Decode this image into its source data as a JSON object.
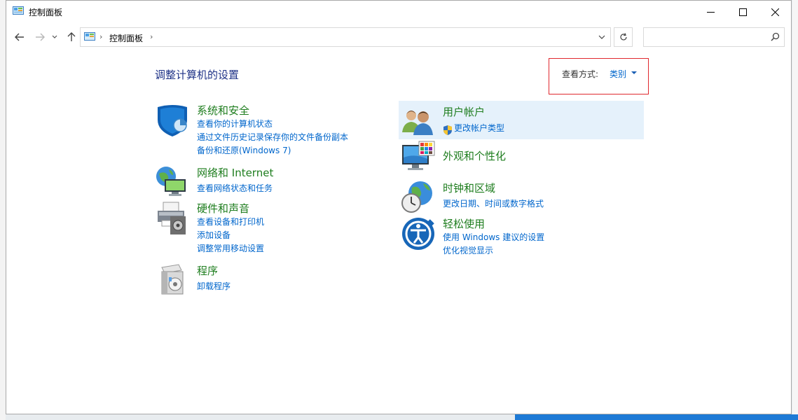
{
  "window": {
    "title": "控制面板"
  },
  "address": {
    "crumbs": [
      "控制面板"
    ],
    "search_placeholder": ""
  },
  "main": {
    "heading": "调整计算机的设置",
    "view_by": {
      "label": "查看方式:",
      "value": "类别"
    }
  },
  "categories": [
    {
      "title": "系统和安全",
      "icon": "shield-icon",
      "links": [
        "查看你的计算机状态",
        "通过文件历史记录保存你的文件备份副本",
        "备份和还原(Windows 7)"
      ]
    },
    {
      "title": "网络和 Internet",
      "icon": "network-icon",
      "links": [
        "查看网络状态和任务"
      ]
    },
    {
      "title": "硬件和声音",
      "icon": "printer-icon",
      "links": [
        "查看设备和打印机",
        "添加设备",
        "调整常用移动设置"
      ]
    },
    {
      "title": "程序",
      "icon": "programs-icon",
      "links": [
        "卸载程序"
      ]
    },
    {
      "title": "用户帐户",
      "icon": "users-icon",
      "links": [
        "更改帐户类型"
      ]
    },
    {
      "title": "外观和个性化",
      "icon": "monitor-palette-icon",
      "links": []
    },
    {
      "title": "时钟和区域",
      "icon": "clock-globe-icon",
      "links": [
        "更改日期、时间或数字格式"
      ]
    },
    {
      "title": "轻松使用",
      "icon": "ease-of-access-icon",
      "links": [
        "使用 Windows 建议的设置",
        "优化视觉显示"
      ]
    }
  ],
  "colors": {
    "title_green": "#1e7d1e",
    "link_blue": "#0066cc",
    "heading_blue": "#1e3287",
    "highlight": "#e5f1fb",
    "red_box": "#e0282e"
  }
}
